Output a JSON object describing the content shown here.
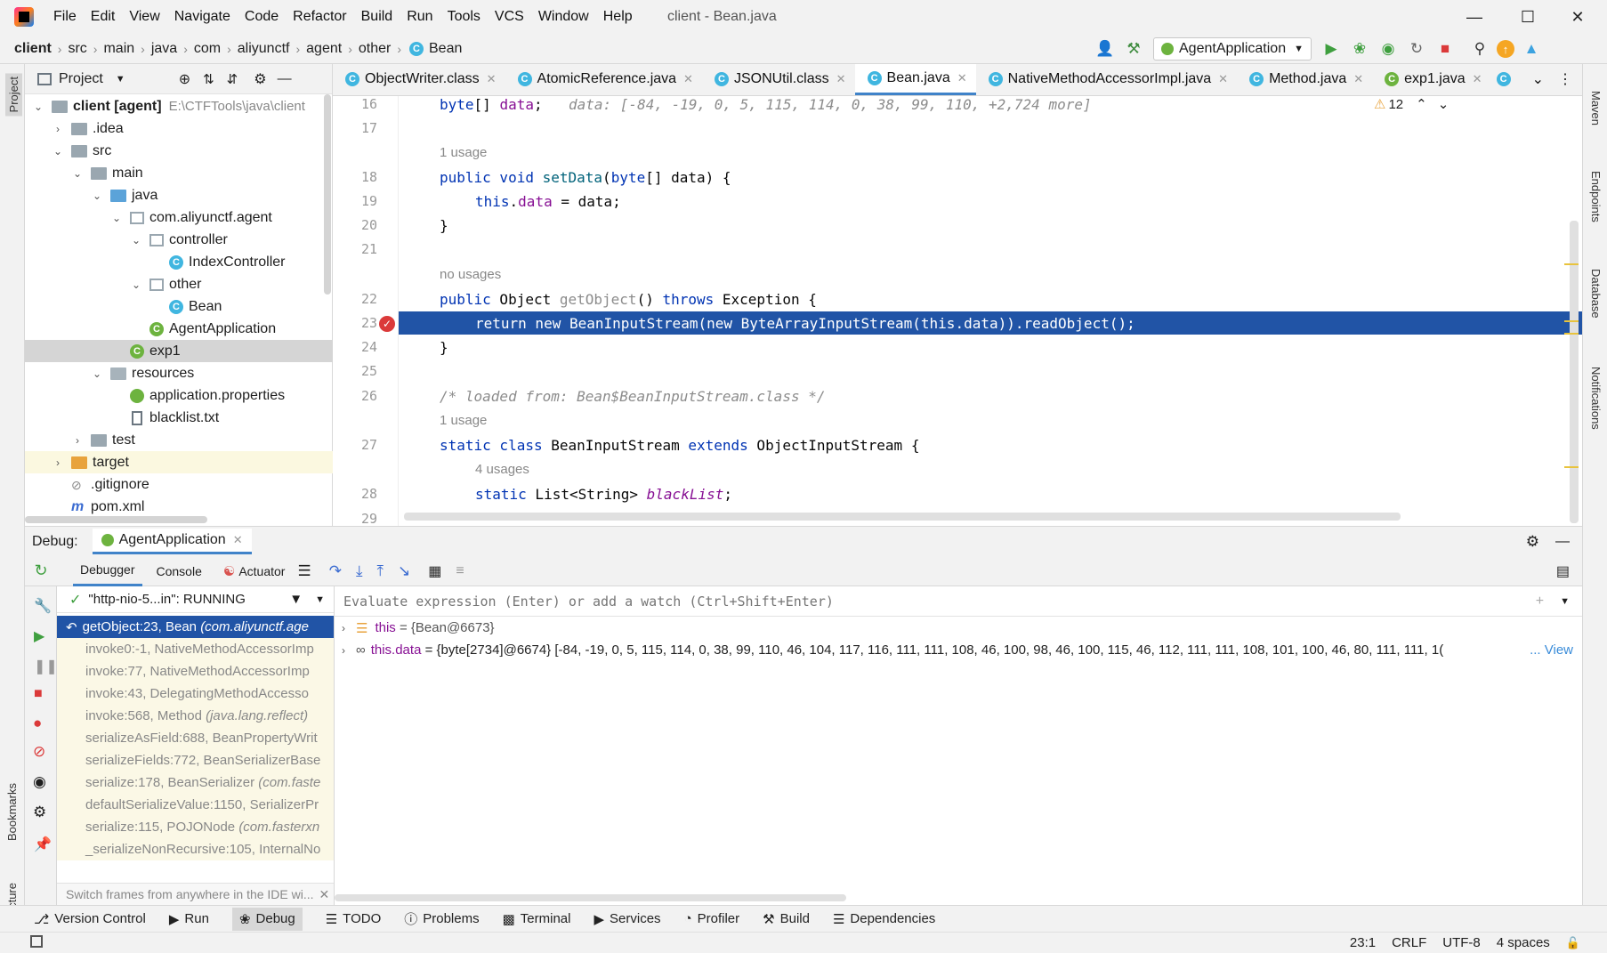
{
  "window": {
    "title": "client - Bean.java"
  },
  "menu": [
    "File",
    "Edit",
    "View",
    "Navigate",
    "Code",
    "Refactor",
    "Build",
    "Run",
    "Tools",
    "VCS",
    "Window",
    "Help"
  ],
  "breadcrumb": [
    "client",
    "src",
    "main",
    "java",
    "com",
    "aliyunctf",
    "agent",
    "other",
    "Bean"
  ],
  "run_config": "AgentApplication",
  "project": {
    "title": "Project",
    "root_name": "client [agent]",
    "root_path": "E:\\CTFTools\\java\\client",
    "items": [
      ".idea",
      "src",
      "main",
      "java",
      "com.aliyunctf.agent",
      "controller",
      "IndexController",
      "other",
      "Bean",
      "AgentApplication",
      "exp1",
      "resources",
      "application.properties",
      "blacklist.txt",
      "test",
      "target",
      ".gitignore",
      "pom.xml"
    ]
  },
  "tabs": [
    "ObjectWriter.class",
    "AtomicReference.java",
    "JSONUtil.class",
    "Bean.java",
    "NativeMethodAccessorImpl.java",
    "Method.java",
    "exp1.java"
  ],
  "editor": {
    "warnings": "12",
    "line_numbers": [
      "16",
      "17",
      "18",
      "19",
      "20",
      "21",
      "22",
      "23",
      "24",
      "25",
      "26",
      "27",
      "28",
      "29"
    ],
    "inline_hint": "data: [-84, -19, 0, 5, 115, 114, 0, 38, 99, 110, +2,724 more]",
    "usage_1": "1 usage",
    "no_usages": "no usages",
    "usage_2": "1 usage",
    "usage_4": "4 usages",
    "comment": "/* loaded from: Bean$BeanInputStream.class */"
  },
  "debug": {
    "label": "Debug:",
    "session": "AgentApplication",
    "tabs": [
      "Debugger",
      "Console",
      "Actuator"
    ],
    "thread": "\"http-nio-5...in\": RUNNING",
    "eval_placeholder": "Evaluate expression (Enter) or add a watch (Ctrl+Shift+Enter)",
    "frames": [
      {
        "method": "getObject:23, Bean",
        "pkg": "(com.aliyunctf.age"
      },
      {
        "method": "invoke0:-1, NativeMethodAccessorImp",
        "pkg": ""
      },
      {
        "method": "invoke:77, NativeMethodAccessorImp",
        "pkg": ""
      },
      {
        "method": "invoke:43, DelegatingMethodAccesso",
        "pkg": ""
      },
      {
        "method": "invoke:568, Method",
        "pkg": "(java.lang.reflect)"
      },
      {
        "method": "serializeAsField:688, BeanPropertyWrit",
        "pkg": ""
      },
      {
        "method": "serializeFields:772, BeanSerializerBase",
        "pkg": ""
      },
      {
        "method": "serialize:178, BeanSerializer",
        "pkg": "(com.faste"
      },
      {
        "method": "defaultSerializeValue:1150, SerializerPr",
        "pkg": ""
      },
      {
        "method": "serialize:115, POJONode",
        "pkg": "(com.fasterxn"
      },
      {
        "method": "_serializeNonRecursive:105, InternalNo",
        "pkg": ""
      }
    ],
    "frames_hint": "Switch frames from anywhere in the IDE wi...",
    "vars": [
      {
        "name": "this",
        "value": "= {Bean@6673}"
      },
      {
        "name": "this.data",
        "value": "= {byte[2734]@6674} [-84, -19, 0, 5, 115, 114, 0, 38, 99, 110, 46, 104, 117, 116, 111, 111, 108, 46, 100, 98, 46, 100, 115, 46, 112, 111, 111, 108, 101, 100, 46, 80, 111, 111, 1(",
        "link": "... View"
      }
    ]
  },
  "bottom_tabs": [
    "Version Control",
    "Run",
    "Debug",
    "TODO",
    "Problems",
    "Terminal",
    "Services",
    "Profiler",
    "Build",
    "Dependencies"
  ],
  "status": {
    "position": "23:1",
    "line_sep": "CRLF",
    "encoding": "UTF-8",
    "indent": "4 spaces"
  },
  "right_stripe": [
    "Maven",
    "Endpoints",
    "Database",
    "Notifications"
  ],
  "left_stripe": [
    "Project",
    "Bookmarks",
    "Structure"
  ],
  "colors": {
    "selection": "#2154a6",
    "keyword": "#0033b3",
    "field": "#871094",
    "accent": "#4083c9"
  }
}
